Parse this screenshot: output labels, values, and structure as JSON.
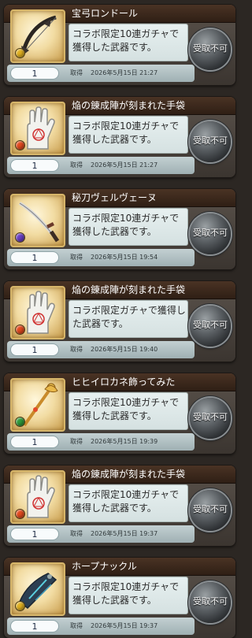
{
  "colors": {
    "accent_gold": "#d7b66a",
    "panel": "#dbe6e6",
    "header": "#3b271a"
  },
  "common": {
    "receive_button": "受取不可",
    "acquired_label": "取得"
  },
  "items": [
    {
      "name": "宝弓ロンドール",
      "desc": "コラボ限定10連ガチャで獲得した武器です。",
      "qty": "1",
      "date": "2026年5月15日 21:27",
      "icon": "bow-icon",
      "element_color": "#e0b020"
    },
    {
      "name": "焔の錬成陣が刻まれた手袋",
      "desc": "コラボ限定10連ガチャで獲得した武器です。",
      "qty": "1",
      "date": "2026年5月15日 21:27",
      "icon": "glove-icon",
      "element_color": "#e34a1e"
    },
    {
      "name": "秘刀ヴェルヴェーヌ",
      "desc": "コラボ限定10連ガチャで獲得した武器です。",
      "qty": "1",
      "date": "2026年5月15日 19:54",
      "icon": "sword-icon",
      "element_color": "#6a3fc4"
    },
    {
      "name": "焔の錬成陣が刻まれた手袋",
      "desc": "コラボ限定ガチャで獲得した武器です。",
      "qty": "1",
      "date": "2026年5月15日 19:40",
      "icon": "glove-icon",
      "element_color": "#e34a1e"
    },
    {
      "name": "ヒヒイロカネ飾ってみた",
      "desc": "コラボ限定10連ガチャで獲得した武器です。",
      "qty": "1",
      "date": "2026年5月15日 19:39",
      "icon": "staff-icon",
      "element_color": "#2f9a3a"
    },
    {
      "name": "焔の錬成陣が刻まれた手袋",
      "desc": "コラボ限定10連ガチャで獲得した武器です。",
      "qty": "1",
      "date": "2026年5月15日 19:37",
      "icon": "glove-icon",
      "element_color": "#e34a1e"
    },
    {
      "name": "ホープナックル",
      "desc": "コラボ限定10連ガチャで獲得した武器です。",
      "qty": "1",
      "date": "2026年5月15日 19:37",
      "icon": "knuckle-icon",
      "element_color": "#e0b020"
    }
  ]
}
